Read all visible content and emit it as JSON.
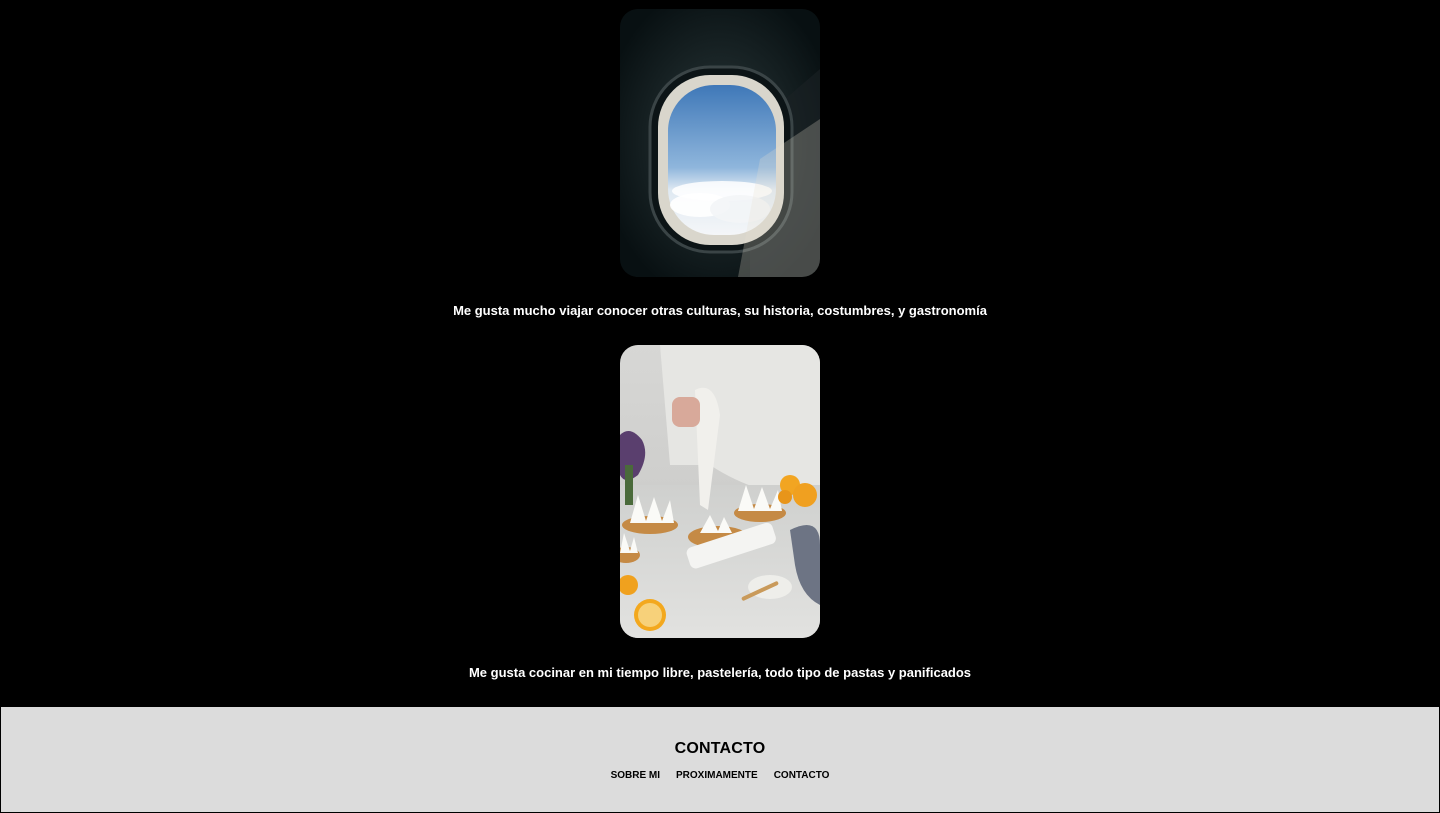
{
  "sections": [
    {
      "image_description_icon": "airplane-window-photo",
      "caption": "Me gusta mucho viajar conocer otras culturas, su historia, costumbres, y gastronomía"
    },
    {
      "image_description_icon": "baking-tarts-photo",
      "caption": "Me gusta cocinar en mi tiempo libre, pastelería, todo tipo de pastas y panificados"
    }
  ],
  "footer": {
    "title": "CONTACTO",
    "nav": [
      "SOBRE MI",
      "PROXIMAMENTE",
      "CONTACTO"
    ]
  },
  "colors": {
    "page_background": "#000000",
    "footer_background": "#dcdcdc",
    "caption_text": "#ffffff"
  }
}
